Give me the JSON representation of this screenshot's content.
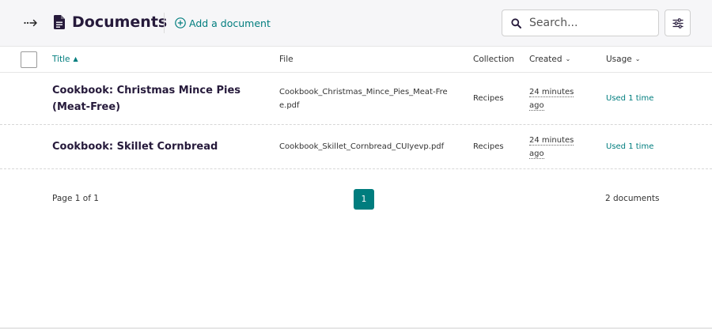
{
  "header": {
    "title": "Documents",
    "title_icon": "document-icon",
    "sidebar_toggle_icon": "arrow-right-icon",
    "add_label": "Add a document",
    "search_placeholder": "Search...",
    "filter_icon": "sliders-icon"
  },
  "table": {
    "columns": {
      "title": "Title",
      "file": "File",
      "collection": "Collection",
      "created": "Created",
      "usage": "Usage"
    },
    "sort": {
      "column": "title",
      "direction": "ascending"
    },
    "rows": [
      {
        "title": "Cookbook: Christmas Mince Pies (Meat-Free)",
        "file": "Cookbook_Christmas_Mince_Pies_Meat-Free.pdf",
        "collection": "Recipes",
        "created": "24 minutes ago",
        "usage": "Used 1 time"
      },
      {
        "title": "Cookbook: Skillet Cornbread",
        "file": "Cookbook_Skillet_Cornbread_CUIyevp.pdf",
        "collection": "Recipes",
        "created": "24 minutes ago",
        "usage": "Used 1 time"
      }
    ]
  },
  "pagination": {
    "page_info": "Page 1 of 1",
    "current_page": "1",
    "count_label": "2 documents"
  },
  "colors": {
    "accent": "#007d7e",
    "title_text": "#261a3b",
    "header_bg": "#f6f6f8"
  }
}
